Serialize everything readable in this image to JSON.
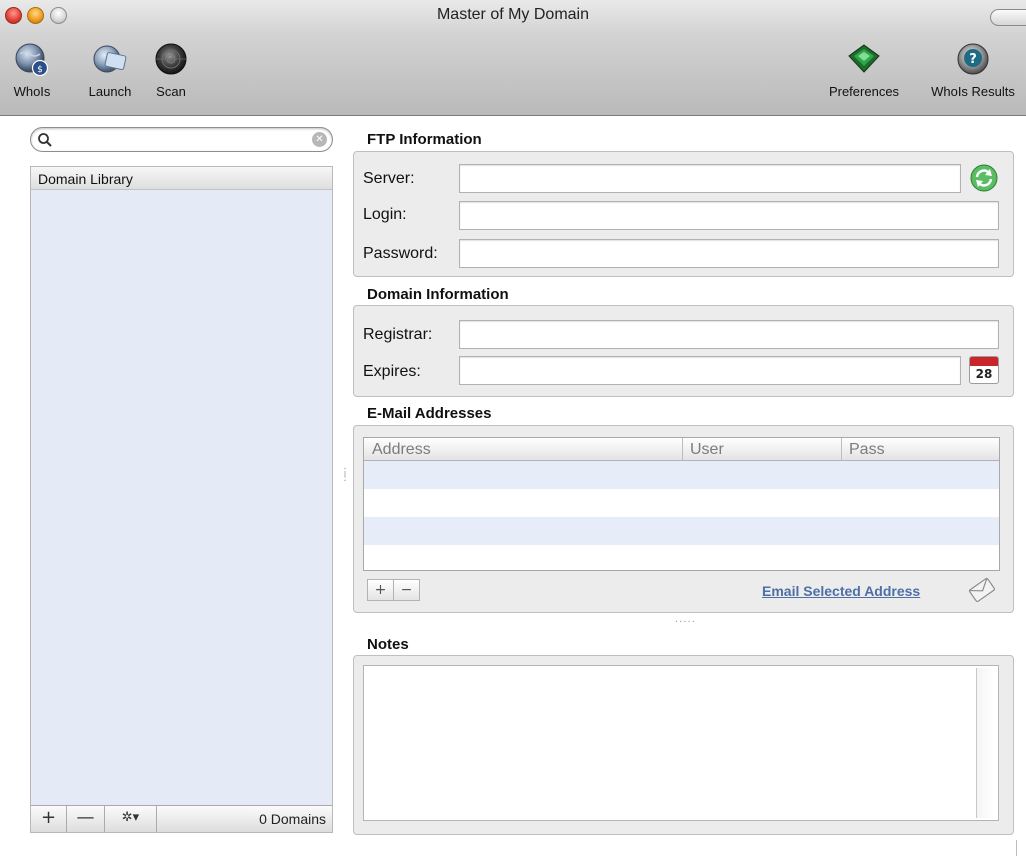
{
  "window": {
    "title": "Master of My Domain"
  },
  "toolbar": {
    "whois_label": "WhoIs",
    "launch_label": "Launch",
    "scan_label": "Scan",
    "preferences_label": "Preferences",
    "whois_results_label": "WhoIs Results"
  },
  "sidebar": {
    "search_value": "",
    "header": "Domain Library",
    "count_label": "0 Domains",
    "add_symbol": "+",
    "remove_symbol": "—",
    "action_symbol": "✲▾"
  },
  "ftp": {
    "title": "FTP Information",
    "server_label": "Server:",
    "server_value": "",
    "login_label": "Login:",
    "login_value": "",
    "password_label": "Password:",
    "password_value": ""
  },
  "domain": {
    "title": "Domain Information",
    "registrar_label": "Registrar:",
    "registrar_value": "",
    "expires_label": "Expires:",
    "expires_value": "",
    "calendar_day": "28"
  },
  "email": {
    "title": "E-Mail Addresses",
    "columns": [
      "Address",
      "User",
      "Pass"
    ],
    "rows": [],
    "add_symbol": "+",
    "remove_symbol": "−",
    "email_selected_label": "Email Selected Address"
  },
  "notes": {
    "title": "Notes",
    "value": ""
  },
  "colors": {
    "link": "#4e6fa6",
    "sidebar_background": "#e4ebf6",
    "alt_row": "#e6edf8"
  }
}
